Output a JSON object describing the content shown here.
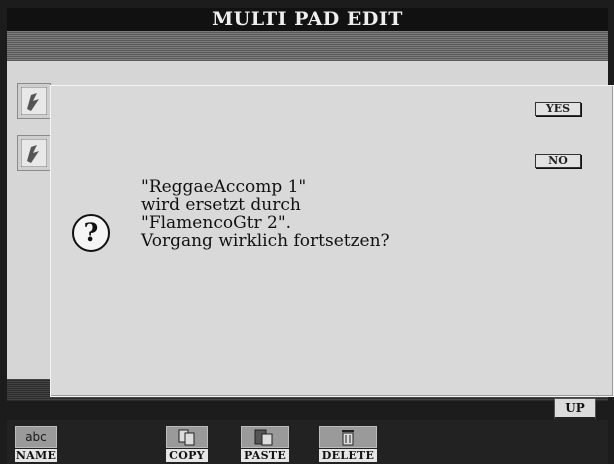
{
  "header": {
    "title": "MULTI PAD EDIT"
  },
  "pads": [
    {
      "icon": "multi-pad-icon"
    },
    {
      "icon": "multi-pad-icon"
    }
  ],
  "dialog": {
    "icon": "question-mark-icon",
    "message": [
      "\"ReggaeAccomp 1\"",
      "wird ersetzt durch",
      "\"FlamencoGtr 2\".",
      "Vorgang wirklich fortsetzen?"
    ],
    "yes_label": "YES",
    "no_label": "NO"
  },
  "nav": {
    "up_label": "UP"
  },
  "function_buttons": {
    "name": {
      "label": "NAME",
      "icon_text": "abc",
      "icon": "folder-abc-icon"
    },
    "copy": {
      "label": "COPY",
      "icon": "copy-icon"
    },
    "paste": {
      "label": "PASTE",
      "icon": "paste-icon"
    },
    "delete": {
      "label": "DELETE",
      "icon": "trash-icon"
    }
  }
}
